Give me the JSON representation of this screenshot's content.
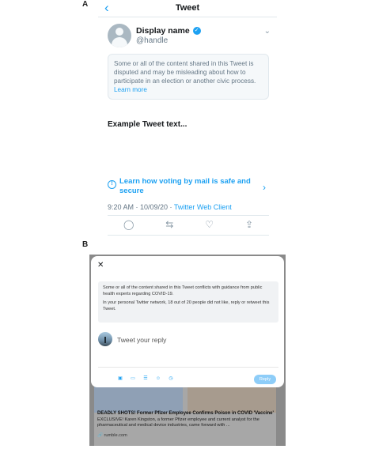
{
  "labels": {
    "a": "A",
    "b": "B"
  },
  "panel_a": {
    "title": "Tweet",
    "back_icon": "chevron-left-icon",
    "display_name": "Display name",
    "handle": "@handle",
    "notice": "Some or all of the content shared in this Tweet is disputed and may be misleading about how to participate in an election or another civic process.",
    "learn_more": "Learn more",
    "tweet_text": "Example Tweet text...",
    "vote_link": "Learn how voting by mail is safe and secure",
    "timestamp": "9:20 AM · 10/09/20 · ",
    "client": "Twitter Web Client",
    "icons": [
      "reply-icon",
      "retweet-icon",
      "like-icon",
      "share-icon"
    ],
    "colors": {
      "accent": "#1da1f2",
      "muted": "#657786"
    }
  },
  "panel_b": {
    "notice_line1": "Some or all of the content shared in this Tweet conflicts with guidance from public health experts regarding COVID-19.",
    "notice_line2": "In your personal Twitter network, 18 out of 20 people did not like, reply or retweet this Tweet.",
    "reply_placeholder": "Tweet your reply",
    "reply_button": "Reply",
    "close_icon": "close-icon",
    "toolbar_icons": [
      "image-icon",
      "gif-icon",
      "poll-icon",
      "emoji-icon",
      "schedule-icon"
    ],
    "background_article": {
      "headline": "DEADLY SHOTS! Former Pfizer Employee Confirms Poison in COVID 'Vaccine'",
      "description": "EXCLUSIVE! Karen Kingston, a former Pfizer employee and current analyst for the pharmaceutical and medical device industries, came forward with ...",
      "domain": "🔗 rumble.com"
    }
  }
}
